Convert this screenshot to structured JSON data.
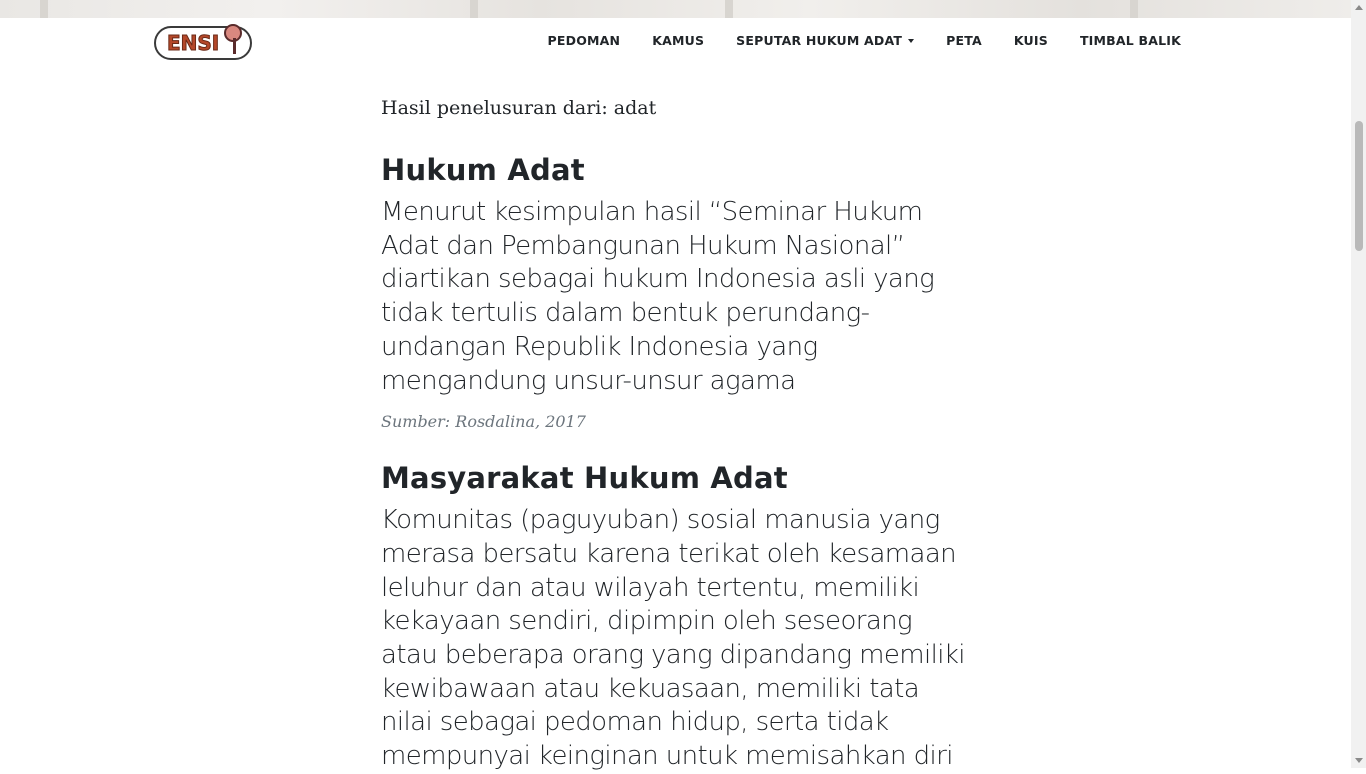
{
  "brand": {
    "logo_text": "ENSI"
  },
  "nav": {
    "items": [
      "PEDOMAN",
      "KAMUS",
      "SEPUTAR HUKUM ADAT",
      "PETA",
      "KUIS",
      "TIMBAL BALIK"
    ]
  },
  "search": {
    "result_header": "Hasil penelusuran dari: adat"
  },
  "entries": [
    {
      "title": "Hukum Adat",
      "definition": "Menurut kesimpulan hasil “Seminar Hukum Adat dan Pembangunan Hukum Nasional” diartikan sebagai hukum Indonesia asli yang tidak tertulis dalam bentuk perundang-undangan Republik Indonesia yang mengandung unsur-unsur agama",
      "source": "Sumber: Rosdalina, 2017"
    },
    {
      "title": "Masyarakat Hukum Adat",
      "definition": "Komunitas (paguyuban) sosial manusia yang merasa bersatu karena terikat oleh kesamaan leluhur dan atau wilayah tertentu, memiliki kekayaan sendiri, dipimpin oleh seseorang atau beberapa orang yang dipandang memiliki kewibawaan atau kekuasaan, memiliki tata nilai sebagai pedoman hidup, serta tidak mempunyai keinginan untuk memisahkan diri"
    }
  ],
  "icons": {
    "dropdown": "caret-down-icon",
    "logo": "magnifier-icon"
  }
}
